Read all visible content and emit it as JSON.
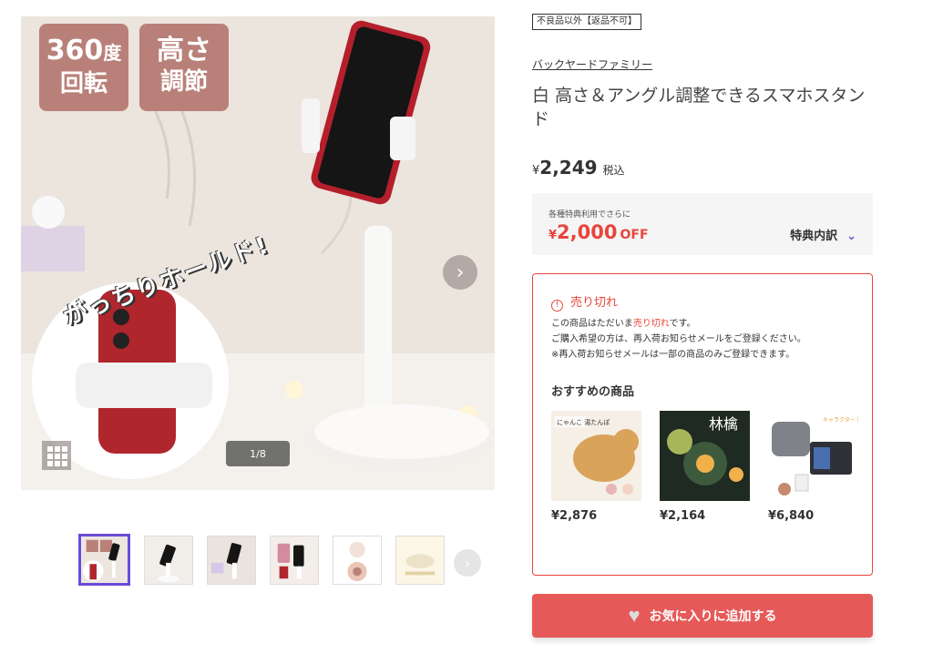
{
  "gallery": {
    "badge_rotate_top": "360",
    "badge_rotate_unit": "度",
    "badge_rotate_bottom": "回転",
    "badge_height_top": "高さ",
    "badge_height_bottom": "調節",
    "hold_text": "がっちりホールド!",
    "counter": "1/8",
    "thumbnail_count": 6,
    "active_thumbnail": 1,
    "icons": {
      "next": "chevron-right-icon",
      "grid": "grid-icon"
    }
  },
  "product": {
    "return_policy": "不良品以外【返品不可】",
    "brand": "バックヤードファミリー",
    "title": "白 高さ＆アングル調整できるスマホスタンド",
    "price_symbol": "¥",
    "price": "2,249",
    "tax_label": "税込"
  },
  "discount": {
    "note": "各種特典利用でさらに",
    "symbol": "¥",
    "amount": "2,000",
    "off": "OFF",
    "link_label": "特典内訳",
    "icon": "chevron-down-icon"
  },
  "soldout": {
    "title": "売り切れ",
    "line1_a": "この商品はただいま",
    "line1_red": "売り切れ",
    "line1_b": "です。",
    "line2": "ご購入希望の方は、再入荷お知らせメールをご登録ください。",
    "line3": "※再入荷お知らせメールは一部の商品のみご登録できます。",
    "recommend_heading": "おすすめの商品",
    "recommendations": [
      {
        "price": "¥2,876",
        "img_text": "にゃんこ 湯たんぽ"
      },
      {
        "price": "¥2,164",
        "img_text": "林檎"
      },
      {
        "price": "¥6,840",
        "img_text": "キャラクター 調剤セット"
      }
    ]
  },
  "actions": {
    "favorite_label": "お気に入りに追加する",
    "favorite_icon": "heart-icon"
  },
  "colors": {
    "accent_red": "#e8453c",
    "button_red": "#e55a58",
    "thumb_active": "#6a4bd8",
    "badge": "#b98079"
  }
}
